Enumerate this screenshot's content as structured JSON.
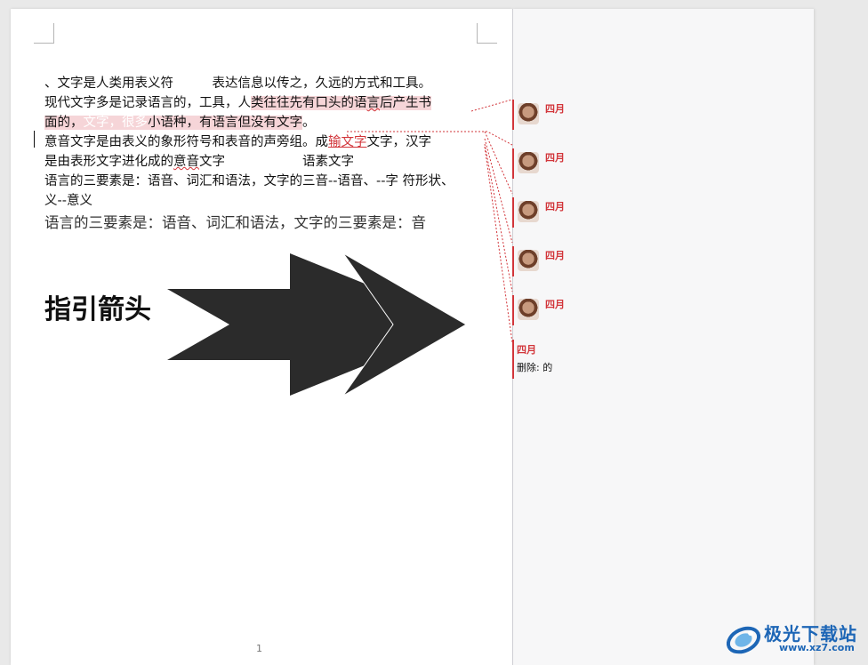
{
  "document": {
    "line1": "、文字是人类用表义符　　　表达信息以传之，久远的方式和工具。",
    "line2_a": "现代文字多是记录语言的，工具，人",
    "line2_b": "类往往先有口头的语",
    "line2_c": "言",
    "line2_d": "后产生书",
    "line3_a": "面的，",
    "line3_b": "文字，很多",
    "line3_c": "小语种，有语言但没有文字",
    "line3_d": "。",
    "line4_a": "意音文字是由表义的象形符号和表音的声旁组。成",
    "line4_b": "输文字",
    "line4_c": "文字，汉字",
    "line5_a": "是由表形文字进化成的",
    "line5_b": "意音",
    "line5_c": "文字　　　　　　语素文字",
    "line6": "语言的三要素是：语音、词汇和语法，文字的三音--语音、--字  符形状、",
    "line7": "义--意义",
    "line8": "语言的三要素是：语音、词汇和语法，文字的三要素是：音",
    "heading": "指引箭头",
    "page_number": "1"
  },
  "markup": {
    "comments": [
      {
        "author": "四月"
      },
      {
        "author": "四月"
      },
      {
        "author": "四月"
      },
      {
        "author": "四月"
      },
      {
        "author": "四月"
      }
    ],
    "deletion": {
      "author": "四月",
      "text": "删除: 的"
    }
  },
  "watermark": {
    "title": "极光下载站",
    "url": "www.xz7.com"
  },
  "colors": {
    "revision": "#d2353a",
    "highlight": "#f6d5d8",
    "arrow": "#2b2b2b",
    "watermark": "#1d66b6"
  },
  "icons": {
    "avatar": "user-avatar-photo",
    "arrow_shape": "double-chevron-arrow",
    "logo": "jiguang-logo-icon"
  }
}
